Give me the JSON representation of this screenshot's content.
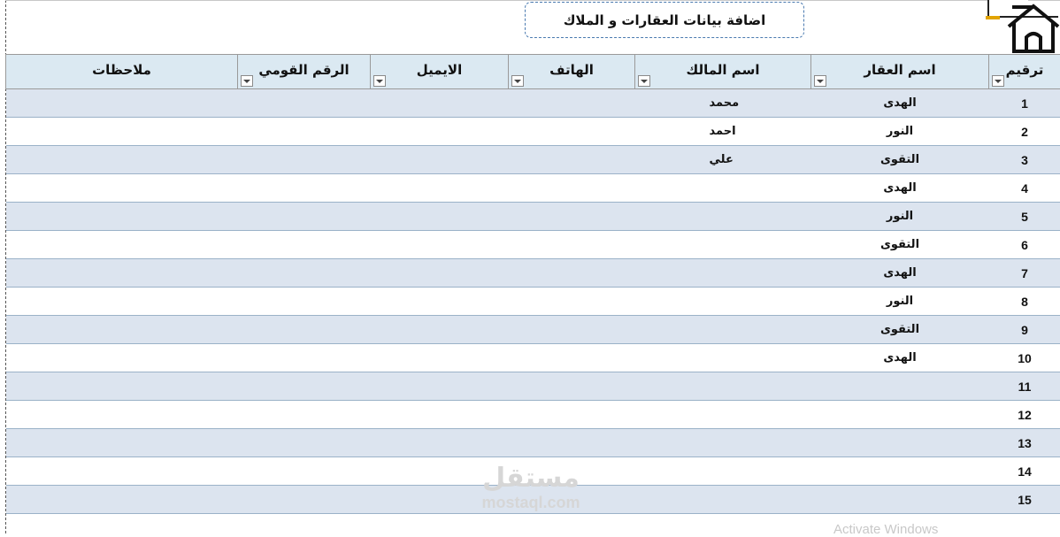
{
  "header": {
    "title_button": "اضافة بيانات العقارات و الملاك"
  },
  "table": {
    "columns": [
      "ترقيم",
      "اسم العقار",
      "اسم المالك",
      "الهاتف",
      "الايميل",
      "الرقم القومي",
      "ملاحظات"
    ],
    "rows": [
      {
        "num": "1",
        "property": "الهدى",
        "owner": "محمد"
      },
      {
        "num": "2",
        "property": "النور",
        "owner": "احمد"
      },
      {
        "num": "3",
        "property": "التقوى",
        "owner": "علي"
      },
      {
        "num": "4",
        "property": "الهدى",
        "owner": ""
      },
      {
        "num": "5",
        "property": "النور",
        "owner": ""
      },
      {
        "num": "6",
        "property": "التقوى",
        "owner": ""
      },
      {
        "num": "7",
        "property": "الهدى",
        "owner": ""
      },
      {
        "num": "8",
        "property": "النور",
        "owner": ""
      },
      {
        "num": "9",
        "property": "التقوى",
        "owner": ""
      },
      {
        "num": "10",
        "property": "الهدى",
        "owner": ""
      },
      {
        "num": "11",
        "property": "",
        "owner": ""
      },
      {
        "num": "12",
        "property": "",
        "owner": ""
      },
      {
        "num": "13",
        "property": "",
        "owner": ""
      },
      {
        "num": "14",
        "property": "",
        "owner": ""
      },
      {
        "num": "15",
        "property": "",
        "owner": ""
      }
    ]
  },
  "watermark": {
    "arabic": "مستقل",
    "latin": "mostaql.com"
  },
  "overlay": {
    "activate": "Activate Windows"
  },
  "icons": {
    "home": "home-icon",
    "dropdown": "filter-dropdown-icon"
  },
  "colors": {
    "header_fill": "#dbe9f2",
    "band_fill": "#dce4ef",
    "title_border": "#4a7ab0"
  }
}
